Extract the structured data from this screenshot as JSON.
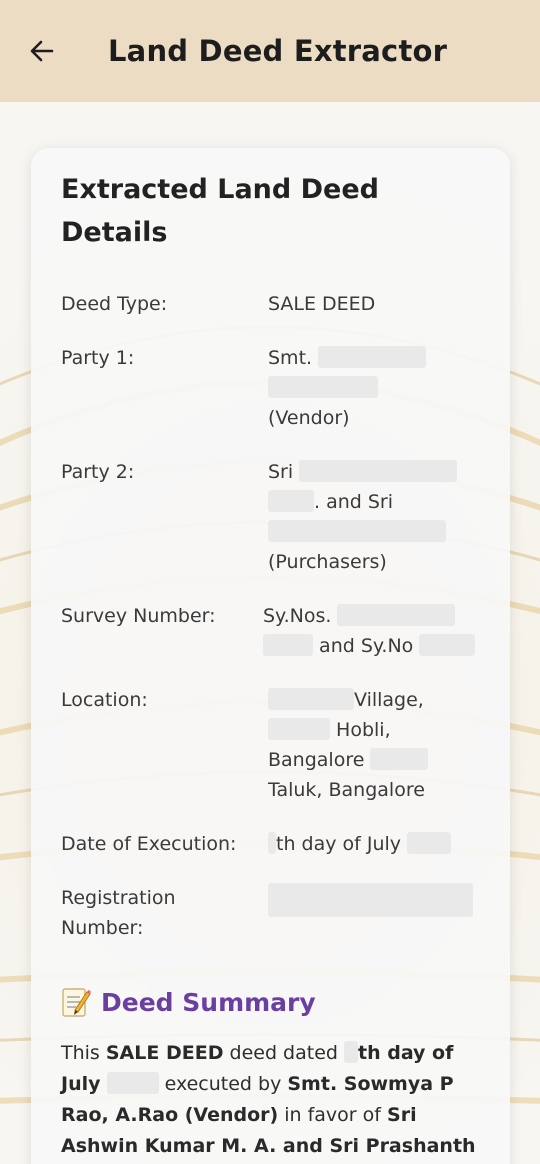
{
  "appbar": {
    "title": "Land Deed Extractor"
  },
  "card": {
    "title": "Extracted Land Deed Details",
    "fields": {
      "deed_type": {
        "label": "Deed Type:",
        "value": "SALE DEED"
      },
      "party1": {
        "label": "Party 1:",
        "prefix": "Smt.",
        "role": "(Vendor)"
      },
      "party2": {
        "label": "Party 2:",
        "prefix": "Sri",
        "mid": ". and Sri",
        "role": "(Purchasers)"
      },
      "survey": {
        "label": "Survey Number:",
        "prefix": "Sy.Nos.",
        "mid": "and Sy.No"
      },
      "location": {
        "label": "Location:",
        "line1": "Village,",
        "line2": "Hobli,",
        "line3": "Bangalore",
        "line4": "Taluk, Bangalore"
      },
      "date": {
        "label": "Date of Execution:",
        "value": "th day of July"
      },
      "registration": {
        "label": "Registration Number:"
      }
    }
  },
  "summary": {
    "heading": "Deed Summary",
    "t1": "This ",
    "t2": "SALE DEED",
    "t3": " deed dated ",
    "t4": "th day of July",
    "t5": "executed by ",
    "t6": "Smt. Sowmya P Rao, A.Rao (Vendor)",
    "t7": " in favor of ",
    "t8": "Sri Ashwin Kumar M. A. and Sri Prashanth"
  },
  "icons": {
    "back": "arrow-left-icon",
    "summary": "memo-icon"
  },
  "colors": {
    "appbar": "#ecdcc3",
    "summary_heading": "#6a3fa0"
  }
}
